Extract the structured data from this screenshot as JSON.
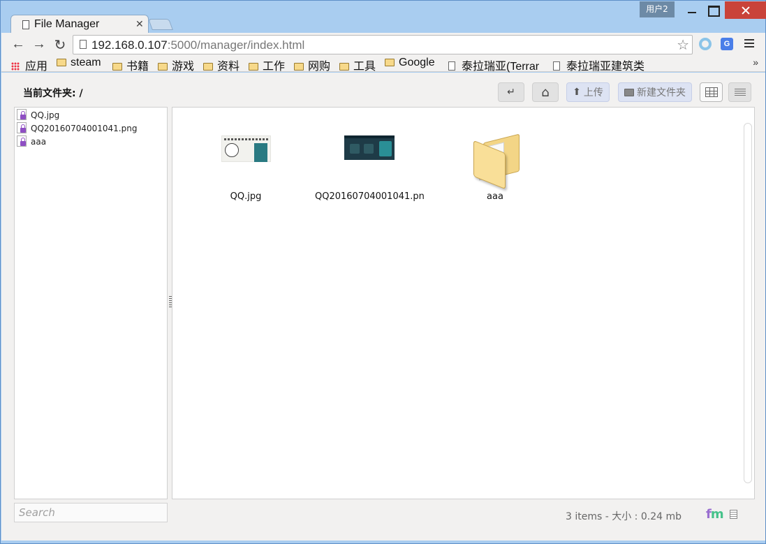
{
  "window": {
    "user_badge": "用户2"
  },
  "tab": {
    "title": "File Manager",
    "close_glyph": "✕"
  },
  "toolbar": {
    "back_glyph": "←",
    "forward_glyph": "→",
    "reload_glyph": "↻",
    "url_host": "192.168.0.107",
    "url_rest": ":5000/manager/index.html",
    "star_glyph": "☆",
    "translate_icon_text": "G"
  },
  "bookmarks": {
    "items": [
      {
        "label": "应用",
        "icon": "apps-icon"
      },
      {
        "label": "steam",
        "icon": "folder-icon"
      },
      {
        "label": "书籍",
        "icon": "folder-icon"
      },
      {
        "label": "游戏",
        "icon": "folder-icon"
      },
      {
        "label": "资料",
        "icon": "folder-icon"
      },
      {
        "label": "工作",
        "icon": "folder-icon"
      },
      {
        "label": "网购",
        "icon": "folder-icon"
      },
      {
        "label": "工具",
        "icon": "folder-icon"
      },
      {
        "label": "Google",
        "icon": "folder-icon"
      },
      {
        "label": "泰拉瑞亚(Terrar",
        "icon": "page-icon"
      },
      {
        "label": "泰拉瑞亚建筑类",
        "icon": "page-icon"
      }
    ],
    "more_glyph": "»"
  },
  "page": {
    "current_folder_label": "当前文件夹: /",
    "buttons": {
      "back_glyph": "↵",
      "home_glyph": "⌂",
      "upload_label": "上传",
      "upload_glyph": "⬆",
      "new_folder_label": "新建文件夹"
    },
    "tree": [
      {
        "name": "QQ.jpg",
        "icon": "locked-file-icon"
      },
      {
        "name": "QQ20160704001041.png",
        "icon": "locked-file-icon"
      },
      {
        "name": "aaa",
        "icon": "locked-file-icon"
      }
    ],
    "items": [
      {
        "name": "QQ.jpg",
        "type": "image"
      },
      {
        "name": "QQ20160704001041.png",
        "type": "image"
      },
      {
        "name": "aaa",
        "type": "folder"
      }
    ],
    "search_placeholder": "Search",
    "status": "3 items - 大小 : 0.24 mb",
    "logo_f": "f",
    "logo_m": "m"
  },
  "colors": {
    "frame": "#a9cdf0",
    "close": "#c9433a",
    "page_bg": "#f2f1f0",
    "accent_button": "#dde3f3",
    "lock": "#8f4fc4"
  }
}
